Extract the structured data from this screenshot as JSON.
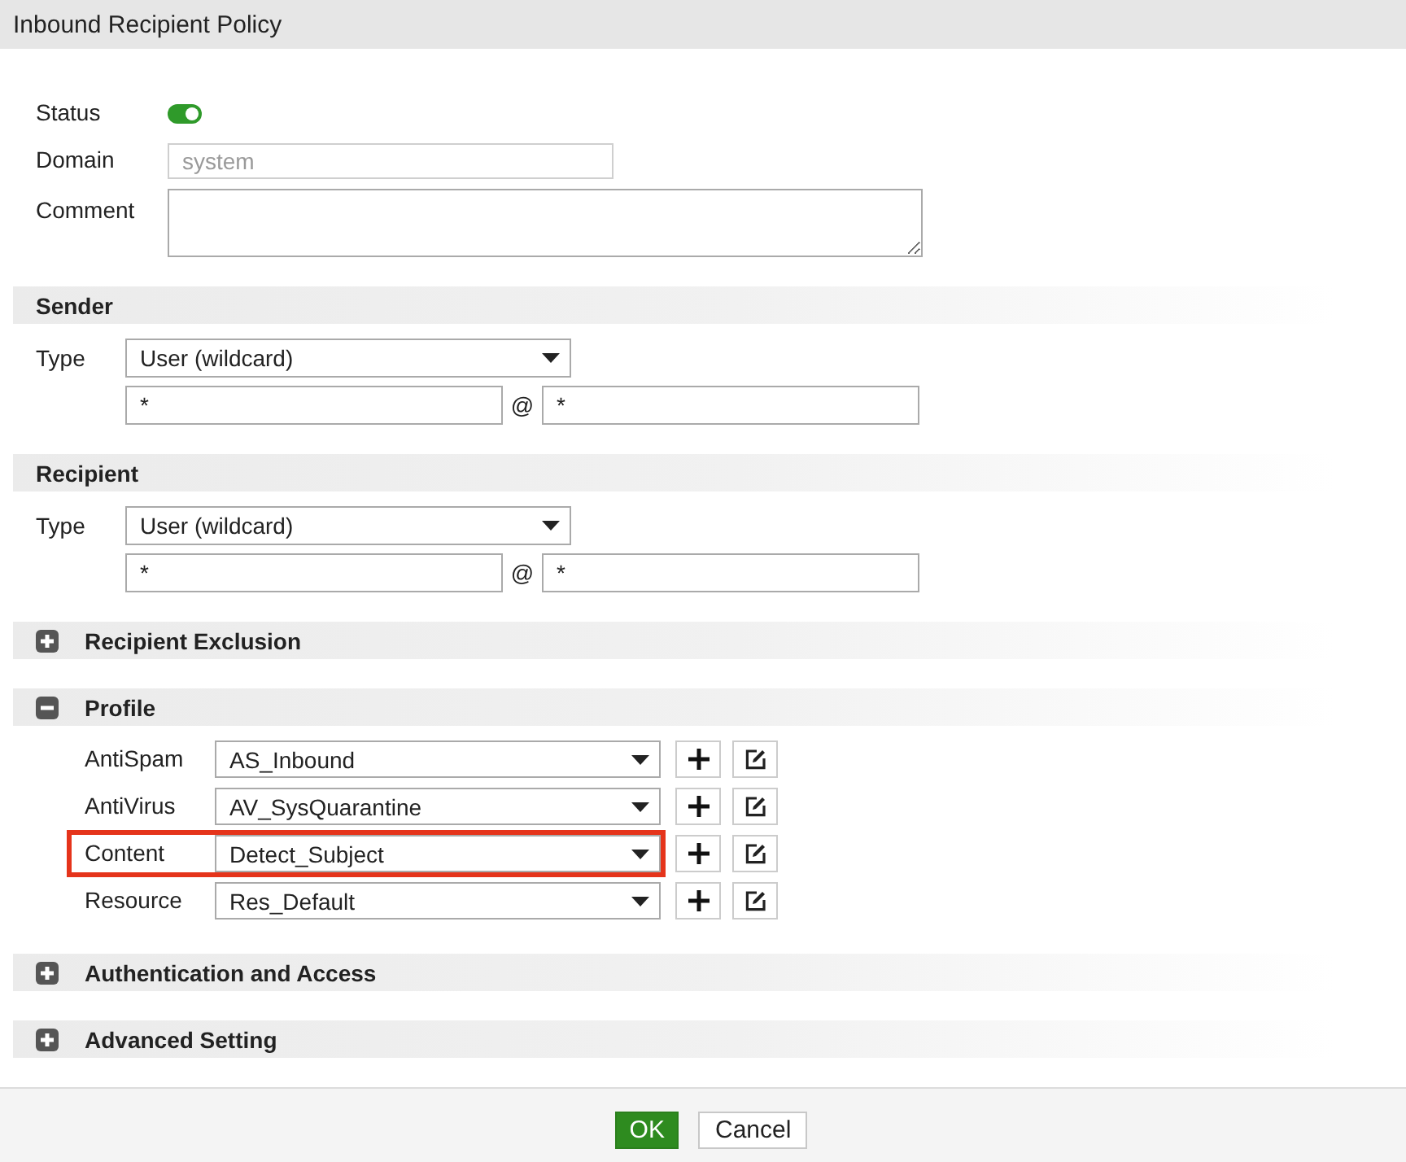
{
  "window": {
    "title": "Inbound Recipient Policy"
  },
  "general": {
    "fields": [
      {
        "kind": "toggle",
        "label": "Status",
        "on": true
      },
      {
        "kind": "text",
        "label": "Domain",
        "value": "system",
        "disabled": true
      },
      {
        "kind": "textarea",
        "label": "Comment"
      }
    ]
  },
  "sections": [
    {
      "kind": "address",
      "title": "Sender",
      "type_label": "Type",
      "type_value": "User (wildcard)",
      "user": "*",
      "at": "@",
      "domain": "*"
    },
    {
      "kind": "address",
      "title": "Recipient",
      "type_label": "Type",
      "type_value": "User (wildcard)",
      "user": "*",
      "at": "@",
      "domain": "*"
    },
    {
      "kind": "collapsible",
      "title": "Recipient Exclusion",
      "expanded": false
    },
    {
      "kind": "profile",
      "title": "Profile",
      "expanded": true,
      "rows": [
        {
          "label": "AntiSpam",
          "value": "AS_Inbound",
          "highlighted": false
        },
        {
          "label": "AntiVirus",
          "value": "AV_SysQuarantine",
          "highlighted": false
        },
        {
          "label": "Content",
          "value": "Detect_Subject",
          "highlighted": true
        },
        {
          "label": "Resource",
          "value": "Res_Default",
          "highlighted": false
        }
      ]
    },
    {
      "kind": "collapsible",
      "title": "Authentication and Access",
      "expanded": false
    },
    {
      "kind": "collapsible",
      "title": "Advanced Setting",
      "expanded": false
    }
  ],
  "buttons": [
    {
      "label": "OK",
      "kind": "primary"
    },
    {
      "label": "Cancel",
      "kind": "secondary"
    }
  ]
}
